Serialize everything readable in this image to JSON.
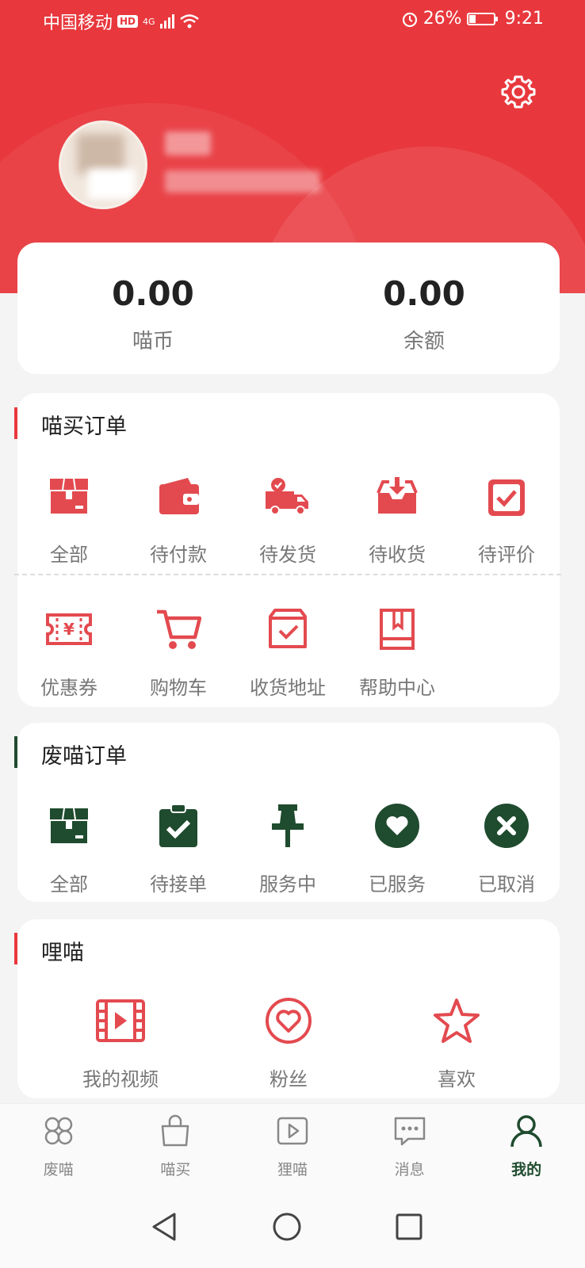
{
  "status_bar": {
    "carrier": "中国移动",
    "hd": "HD",
    "network": "4G",
    "battery": "26%",
    "time": "9:21",
    "battery_level": 0.26
  },
  "balances": [
    {
      "value": "0.00",
      "label": "喵币"
    },
    {
      "value": "0.00",
      "label": "余额"
    }
  ],
  "sections": {
    "miaomai": {
      "title": "喵买订单",
      "row1": [
        {
          "label": "全部",
          "icon": "box-icon"
        },
        {
          "label": "待付款",
          "icon": "wallet-icon"
        },
        {
          "label": "待发货",
          "icon": "truck-icon"
        },
        {
          "label": "待收货",
          "icon": "inbox-download-icon"
        },
        {
          "label": "待评价",
          "icon": "checkbox-icon"
        }
      ],
      "row2": [
        {
          "label": "优惠券",
          "icon": "coupon-icon"
        },
        {
          "label": "购物车",
          "icon": "cart-icon"
        },
        {
          "label": "收货地址",
          "icon": "address-box-icon"
        },
        {
          "label": "帮助中心",
          "icon": "book-icon"
        }
      ]
    },
    "feimiao": {
      "title": "废喵订单",
      "items": [
        {
          "label": "全部",
          "icon": "box-icon"
        },
        {
          "label": "待接单",
          "icon": "clipboard-check-icon"
        },
        {
          "label": "服务中",
          "icon": "pin-icon"
        },
        {
          "label": "已服务",
          "icon": "heart-circle-icon"
        },
        {
          "label": "已取消",
          "icon": "x-circle-icon"
        }
      ]
    },
    "limiao": {
      "title": "哩喵",
      "items": [
        {
          "label": "我的视频",
          "icon": "film-icon"
        },
        {
          "label": "粉丝",
          "icon": "heart-outline-circle-icon"
        },
        {
          "label": "喜欢",
          "icon": "star-icon"
        }
      ]
    }
  },
  "tabs": [
    {
      "label": "废喵",
      "icon": "clover-icon"
    },
    {
      "label": "喵买",
      "icon": "shopping-bag-icon"
    },
    {
      "label": "狸喵",
      "icon": "video-play-icon"
    },
    {
      "label": "消息",
      "icon": "chat-icon"
    },
    {
      "label": "我的",
      "icon": "person-icon",
      "active": true
    }
  ],
  "colors": {
    "red": "#e8383d",
    "green": "#1f4b2e",
    "icon_red": "#e34a4f"
  }
}
